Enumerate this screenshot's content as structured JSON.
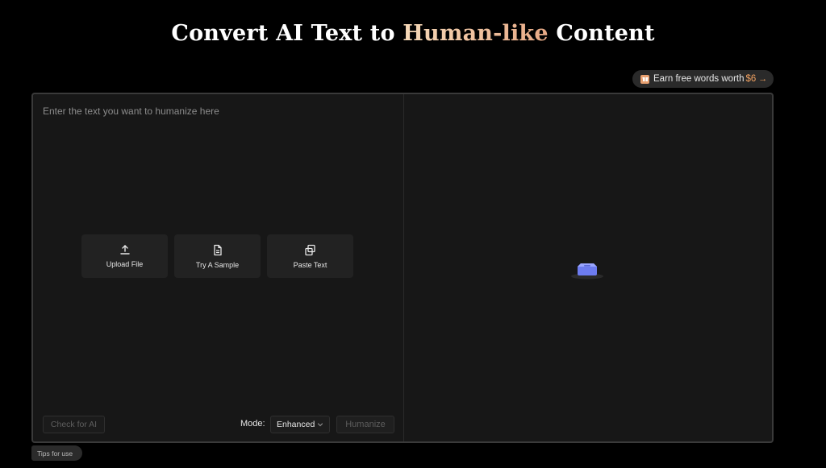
{
  "header": {
    "title_start": "Convert AI Text to ",
    "title_highlight": "Human-like",
    "title_end": " Content"
  },
  "promo": {
    "label": "Earn free words worth",
    "amount": "$6",
    "arrow": "→"
  },
  "input": {
    "placeholder": "Enter the text you want to humanize here"
  },
  "actions": [
    {
      "label": "Upload File",
      "icon": "upload-icon"
    },
    {
      "label": "Try A Sample",
      "icon": "document-icon"
    },
    {
      "label": "Paste Text",
      "icon": "copy-icon"
    }
  ],
  "footer": {
    "check_label": "Check for AI",
    "mode_label": "Mode:",
    "mode_value": "Enhanced",
    "humanize_label": "Humanize"
  },
  "tips": {
    "label": "Tips for use"
  },
  "colors": {
    "accent": "#f0a060",
    "highlight_gradient_start": "#f6d9b8",
    "highlight_gradient_end": "#e7a985",
    "loader": "#6d7cf0"
  }
}
